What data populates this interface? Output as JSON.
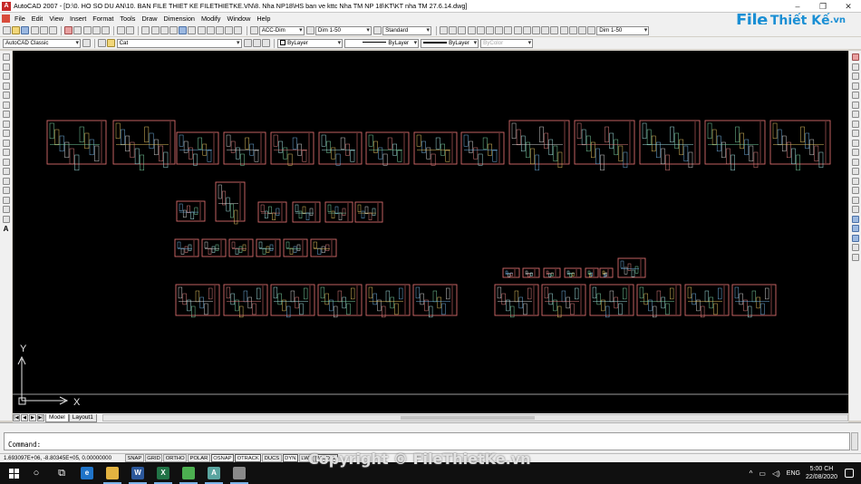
{
  "window": {
    "title": "AutoCAD 2007 - [D:\\0. HO SO DU AN\\10. BAN FILE THIET KE FILETHIETKE.VN\\8. Nha NP18\\HS ban ve kttc Nha TM NP 18\\KT\\KT nha TM 27.6.14.dwg]",
    "minimize": "–",
    "restore": "❐",
    "close": "✕"
  },
  "menu": [
    "File",
    "Edit",
    "View",
    "Insert",
    "Format",
    "Tools",
    "Draw",
    "Dimension",
    "Modify",
    "Window",
    "Help"
  ],
  "toolbar1": {
    "dimstyle": "ACC-Dim",
    "scale1": "Dim 1-50",
    "textstyle": "Standard",
    "scale2": "Dim 1-50"
  },
  "toolbar2": {
    "workspace": "AutoCAD Classic",
    "layer": "Cat",
    "color": "ByLayer",
    "linetype": "ByLayer",
    "lineweight": "ByLayer",
    "plotstyle": "ByColor"
  },
  "logo": {
    "file": "File",
    "thiet": "Thiết Kế",
    "vn": ".vn"
  },
  "ucs": {
    "x_label": "X",
    "y_label": "Y"
  },
  "layout_tabs": [
    "Model",
    "Layout1"
  ],
  "command": {
    "prompt": "Command:"
  },
  "status": {
    "coords": "1.693097E+06, -8.80345E+05, 0.00000000",
    "toggles": [
      "SNAP",
      "GRID",
      "ORTHO",
      "POLAR",
      "OSNAP",
      "OTRACK",
      "DUCS",
      "DYN",
      "LWT",
      "MODEL"
    ]
  },
  "copyright": "Copyright © FileThietKe.vn",
  "taskbar": {
    "language": "ENG",
    "time": "5:00 CH",
    "date": "22/08/2020",
    "apps": [
      {
        "name": "edge-icon",
        "letter": "e",
        "color": "#1f74c9"
      },
      {
        "name": "file-explorer-icon",
        "letter": "",
        "color": "#e3b341"
      },
      {
        "name": "word-icon",
        "letter": "W",
        "color": "#2b579a"
      },
      {
        "name": "excel-icon",
        "letter": "X",
        "color": "#217346"
      },
      {
        "name": "chrome-icon",
        "letter": "",
        "color": "#4caf50"
      },
      {
        "name": "autocad-icon",
        "letter": "A",
        "color": "#5aa5a0"
      },
      {
        "name": "misc-app-icon",
        "letter": "",
        "color": "#8a8a8a"
      }
    ]
  },
  "colors": {
    "drawing_bg": "#000000",
    "sheet_border": "#d46a6a",
    "accent": "#1a8fd4"
  }
}
